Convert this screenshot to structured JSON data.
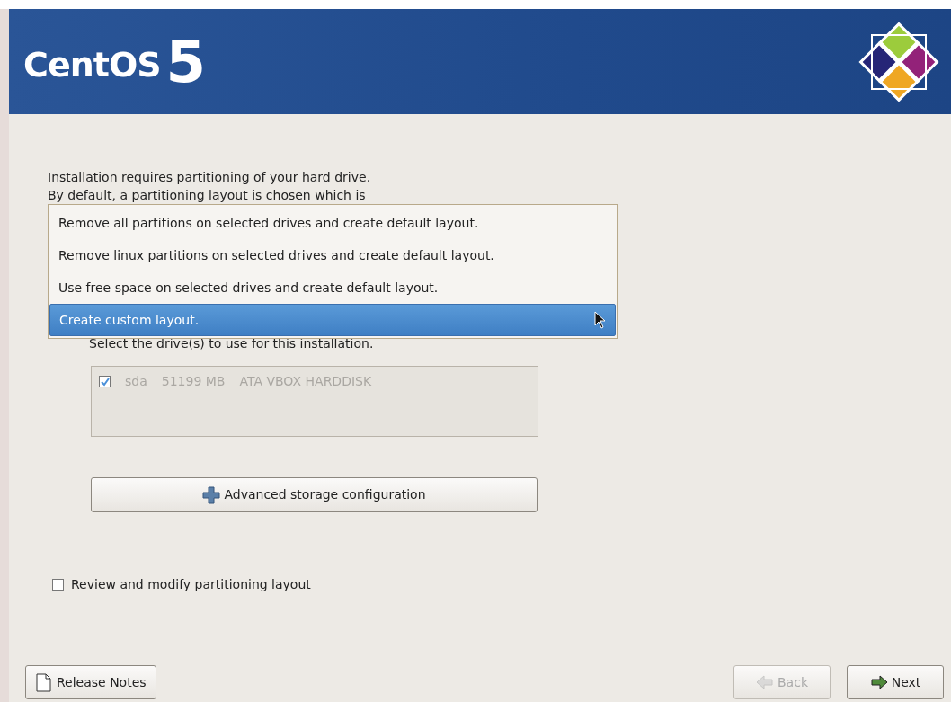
{
  "header": {
    "brand": "CentOS",
    "version": "5"
  },
  "intro": [
    "Installation requires partitioning of your hard drive.",
    "By default, a partitioning layout is chosen which is"
  ],
  "layout_menu": {
    "options": [
      {
        "label": "Remove all partitions on selected drives and create default layout.",
        "selected": false
      },
      {
        "label": "Remove linux partitions on selected drives and create default layout.",
        "selected": false
      },
      {
        "label": "Use free space on selected drives and create default layout.",
        "selected": false
      },
      {
        "label": "Create custom layout.",
        "selected": true
      }
    ]
  },
  "drives_label": "Select the drive(s) to use for this installation.",
  "drives": {
    "disabled": true,
    "items": [
      {
        "checked": true,
        "name": "sda",
        "size": "51199 MB",
        "model": "ATA VBOX HARDDISK"
      }
    ]
  },
  "advanced_button": "Advanced storage configuration",
  "review": {
    "label": "Review and modify partitioning layout",
    "checked": false
  },
  "buttons": [
    {
      "label": "Release Notes",
      "kind": "notes",
      "disabled": false
    },
    {
      "label": "Back",
      "kind": "back",
      "disabled": true
    },
    {
      "label": "Next",
      "kind": "next",
      "disabled": false
    }
  ]
}
